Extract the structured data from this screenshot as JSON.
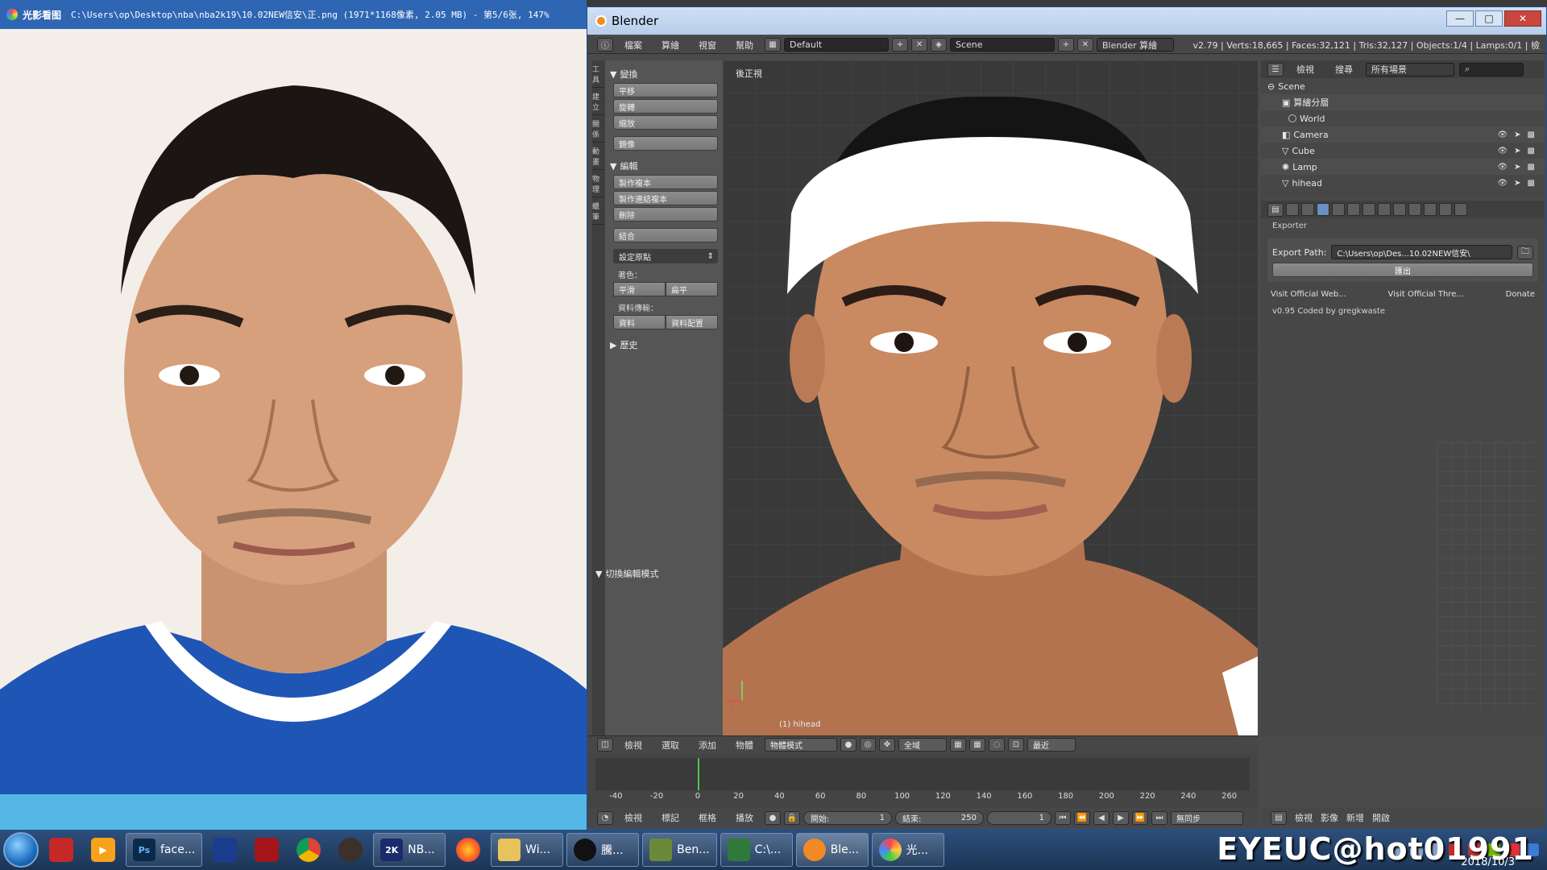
{
  "viewer": {
    "app_name": "光影看图",
    "title_path": "C:\\Users\\op\\Desktop\\nba\\nba2k19\\10.02NEW信安\\正.png (1971*1168像素, 2.05 MB) - 第5/6张, 147%"
  },
  "blender": {
    "window_title": "Blender",
    "window_controls": {
      "minimize": "—",
      "maximize": "□",
      "close": "✕"
    },
    "menu": [
      "檔案",
      "算繪",
      "視窗",
      "幫助"
    ],
    "layout": "Default",
    "scene": "Scene",
    "engine": "Blender 算繪",
    "stats": "v2.79 | Verts:18,665 | Faces:32,121 | Tris:32,127 | Objects:1/4 | Lamps:0/1 | 檢",
    "tool_tabs": [
      "工具",
      "建立",
      "關係",
      "動畫",
      "物理",
      "蠟筆"
    ],
    "toolshelf": {
      "transform_header": "變換",
      "transform_buttons": [
        "平移",
        "旋轉",
        "縮放",
        "鏡像"
      ],
      "edit_header": "編輯",
      "edit_buttons": [
        "製作複本",
        "製作連結複本",
        "刪除",
        "結合"
      ],
      "set_origin": "設定原點",
      "shading_label": "著色：",
      "shading_buttons": [
        "平滑",
        "扁平"
      ],
      "data_transfer_label": "資料傳輸：",
      "data_transfer_buttons": [
        "資料",
        "資料配置"
      ],
      "history_header": "歷史",
      "toggle_edit_header": "切換編輯模式"
    },
    "viewport": {
      "view_label": "後正視",
      "object_label": "(1) hihead"
    },
    "outliner": {
      "view_label": "檢視",
      "search_label": "搜尋",
      "filter": "所有場景",
      "items": [
        {
          "name": "Scene"
        },
        {
          "name": "算繪分層"
        },
        {
          "name": "World"
        },
        {
          "name": "Camera"
        },
        {
          "name": "Cube"
        },
        {
          "name": "Lamp"
        },
        {
          "name": "hihead"
        }
      ]
    },
    "properties": {
      "section": "Exporter",
      "export_path_label": "Export Path:",
      "export_path_value": "C:\\Users\\op\\Des...10.02NEW信安\\",
      "export_button": "匯出",
      "links": [
        "Visit Official Web...",
        "Visit Official Thre...",
        "Donate"
      ],
      "credit": "v0.95 Coded by gregkwaste"
    },
    "view_header": {
      "menus": [
        "檢視",
        "選取",
        "添加",
        "物體"
      ],
      "mode": "物體模式",
      "pivot": "全域",
      "snap": "最近"
    },
    "timeline": {
      "ticks": [
        -40,
        -20,
        0,
        20,
        40,
        60,
        80,
        100,
        120,
        140,
        160,
        180,
        200,
        220,
        240,
        260
      ],
      "tick_min": -50,
      "tick_max": 270,
      "current_frame_value": 0,
      "menus": [
        "檢視",
        "標記",
        "框格",
        "播放"
      ],
      "start_label": "開始:",
      "start_value": "1",
      "end_label": "結束:",
      "end_value": "250",
      "current_frame": "1",
      "sync": "無同步"
    },
    "props_footer": [
      "檢視",
      "影像",
      "新增",
      "開啟"
    ]
  },
  "taskbar": {
    "buttons": [
      {
        "label": "face...",
        "icon": "photoshop-icon",
        "glyph": "Ps"
      },
      {
        "label": "NB...",
        "icon": "nba2k19-icon",
        "glyph": "2K"
      },
      {
        "label": "Wi...",
        "icon": "folder-icon",
        "glyph": ""
      },
      {
        "label": "騰...",
        "icon": "qq-icon",
        "glyph": ""
      },
      {
        "label": "Ben...",
        "icon": "benchmark-icon",
        "glyph": ""
      },
      {
        "label": "C:\\...",
        "icon": "terminal-icon",
        "glyph": ""
      },
      {
        "label": "Ble...",
        "icon": "blender-icon",
        "glyph": ""
      },
      {
        "label": "光...",
        "icon": "viewer-icon",
        "glyph": ""
      }
    ],
    "watermark": "EYEUC@hot01991",
    "date": "2018/10/3"
  },
  "colors": {
    "blender_accent": "#6a8fc1",
    "timeline_cursor": "#4cc84c",
    "taskbar": "#1b3556"
  }
}
